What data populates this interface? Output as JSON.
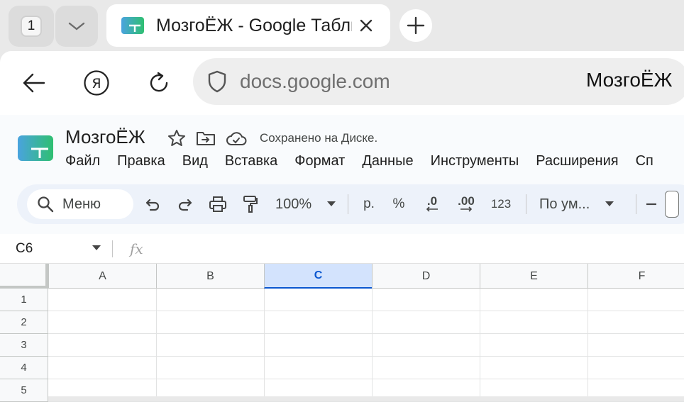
{
  "browser": {
    "tab_count": "1",
    "active_tab_title": "МозгоЁЖ - Google Таблицы",
    "address_url": "docs.google.com",
    "address_page_title": "МозгоЁЖ"
  },
  "sheets": {
    "doc_title": "МозгоЁЖ",
    "save_status": "Сохранено на Диске.",
    "menu": [
      "Файл",
      "Правка",
      "Вид",
      "Вставка",
      "Формат",
      "Данные",
      "Инструменты",
      "Расширения",
      "Сп"
    ],
    "toolbar": {
      "search_label": "Меню",
      "zoom": "100%",
      "currency": "р.",
      "percent": "%",
      "decrease_decimals": ".0",
      "increase_decimals": ".00",
      "number_format": "123",
      "font_name": "По ум..."
    },
    "name_box": "C6",
    "fx_label": "fx"
  },
  "grid": {
    "columns": [
      "A",
      "B",
      "C",
      "D",
      "E",
      "F"
    ],
    "active_column": "C",
    "rows": [
      "1",
      "2",
      "3",
      "4",
      "5"
    ]
  },
  "colors": {
    "sheets_green": "#0f9d58",
    "selection_blue": "#d3e3fd",
    "selection_text": "#0b57d0"
  }
}
